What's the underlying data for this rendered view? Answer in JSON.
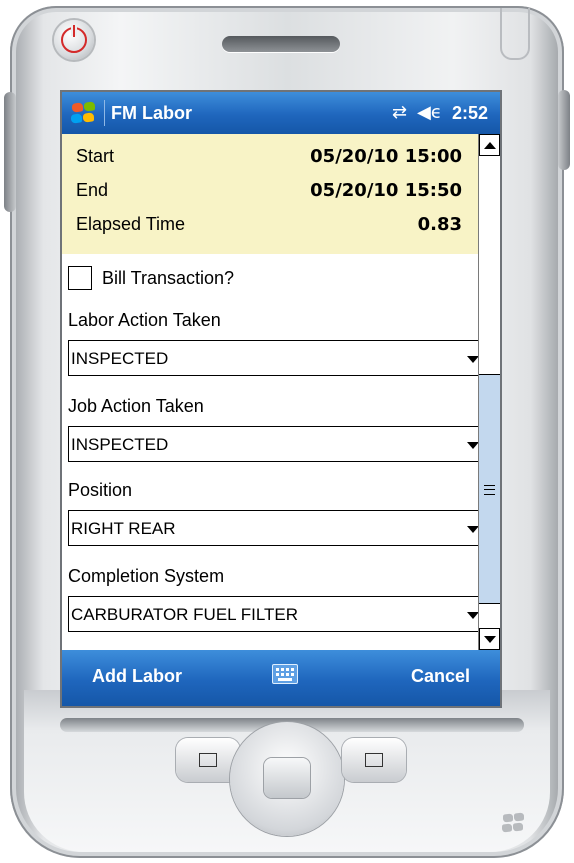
{
  "device": {
    "power_icon": "power-icon",
    "speaker": "speaker-grille"
  },
  "titlebar": {
    "start_icon": "windows-flag-icon",
    "app_title": "FM Labor",
    "sync_icon": "sync-icon",
    "volume_icon": "volume-icon",
    "time": "2:52"
  },
  "summary": {
    "start_label": "Start",
    "start_value": "05/20/10 15:00",
    "end_label": "End",
    "end_value": "05/20/10 15:50",
    "elapsed_label": "Elapsed Time",
    "elapsed_value": "0.83"
  },
  "form": {
    "bill_label": "Bill Transaction?",
    "bill_checked": false,
    "labor_action_label": "Labor Action Taken",
    "labor_action_value": "INSPECTED",
    "job_action_label": "Job Action Taken",
    "job_action_value": "INSPECTED",
    "position_label": "Position",
    "position_value": "RIGHT REAR",
    "completion_label": "Completion System",
    "completion_value": "CARBURATOR FUEL FILTER"
  },
  "softkeys": {
    "left": "Add Labor",
    "keyboard_icon": "keyboard-icon",
    "right": "Cancel"
  },
  "colors": {
    "titlebar_blue": "#1f66bd",
    "summary_bg": "#f8f3c6",
    "scroll_thumb": "#c3d8ee",
    "power_red": "#d42a2a"
  }
}
